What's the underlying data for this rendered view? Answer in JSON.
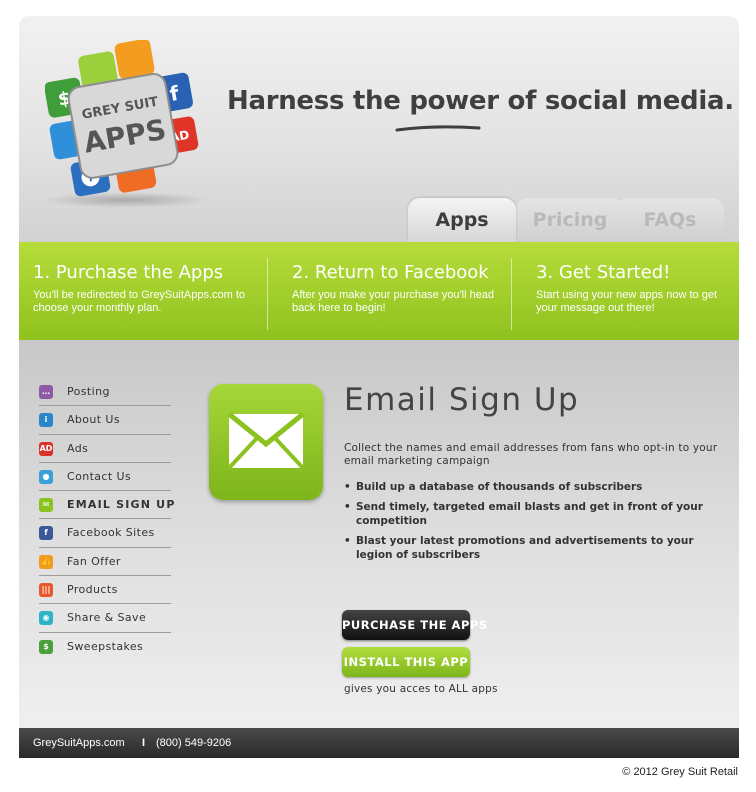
{
  "header": {
    "logo_line1": "GREY SUIT",
    "logo_line2": "APPS",
    "headline_before": "Harness the ",
    "headline_power": "power",
    "headline_after": " of social media."
  },
  "tabs": [
    {
      "label": "Apps",
      "active": true
    },
    {
      "label": "Pricing",
      "active": false
    },
    {
      "label": "FAQs",
      "active": false
    }
  ],
  "steps": [
    {
      "title": "1. Purchase the Apps",
      "text": "You'll be redirected to GreySuitApps.com to choose your monthly plan."
    },
    {
      "title": "2. Return to Facebook",
      "text": "After you make your purchase you'll head back here to begin!"
    },
    {
      "title": "3. Get Started!",
      "text": "Start using your new apps now to get your message out there!"
    }
  ],
  "sidebar": {
    "items": [
      {
        "label": "Posting",
        "icon": "speech-bubble-icon",
        "color": "#8e5aa6",
        "glyph": "…"
      },
      {
        "label": "About Us",
        "icon": "info-icon",
        "color": "#2a86c9",
        "glyph": "i"
      },
      {
        "label": "Ads",
        "icon": "ad-icon",
        "color": "#d9322c",
        "glyph": "AD"
      },
      {
        "label": "Contact Us",
        "icon": "map-pin-icon",
        "color": "#3aa0d8",
        "glyph": "●"
      },
      {
        "label": "EMAIL SIGN UP",
        "icon": "envelope-icon",
        "color": "#8cc21f",
        "glyph": "✉",
        "active": true
      },
      {
        "label": "Facebook Sites",
        "icon": "facebook-icon",
        "color": "#3b5998",
        "glyph": "f"
      },
      {
        "label": "Fan Offer",
        "icon": "thumbs-up-icon",
        "color": "#f09a1e",
        "glyph": "👍"
      },
      {
        "label": "Products",
        "icon": "barcode-icon",
        "color": "#e8572a",
        "glyph": "|||"
      },
      {
        "label": "Share & Save",
        "icon": "camera-icon",
        "color": "#2bb5c6",
        "glyph": "◉"
      },
      {
        "label": "Sweepstakes",
        "icon": "dollar-icon",
        "color": "#4aa03a",
        "glyph": "$"
      }
    ]
  },
  "main": {
    "title": "Email Sign Up",
    "description": "Collect the names and email addresses from fans who opt-in to your email marketing campaign",
    "bullets": [
      "Build up a database of thousands of subscribers",
      "Send timely, targeted email blasts and get in front of your competition",
      "Blast your latest promotions and advertisements to your legion of subscribers"
    ],
    "purchase_label": "PURCHASE THE APPS",
    "install_label": "INSTALL THIS APP",
    "note": "gives you acces to ALL apps"
  },
  "footer": {
    "site": "GreySuitApps.com",
    "separator": "I",
    "phone": "(800) 549-9206"
  },
  "copyright": "© 2012 Grey Suit Retail",
  "colors": {
    "accent_green": "#8cc21f",
    "dark_button": "#1c1c1c",
    "footer_bg": "#333333"
  }
}
